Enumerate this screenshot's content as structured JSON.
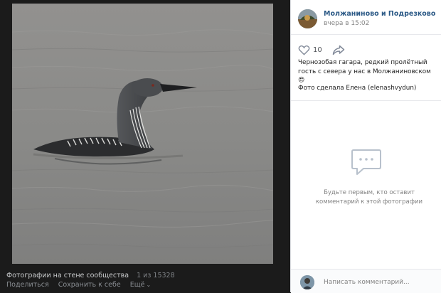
{
  "viewer": {
    "album_title": "Фотографии на стене сообщества",
    "counter": "1 из 15328",
    "actions": {
      "share": "Поделиться",
      "save": "Сохранить к себе",
      "more": "Ещё"
    }
  },
  "post": {
    "group_name": "Молжаниново и Подрезково",
    "time": "вчера в 15:02",
    "likes": "10",
    "description": "Чернозобая гагара, редкий пролётный гость с севера у нас в Молжаниновском 😍",
    "credit": "Фото сделала Елена (elenashvydun)"
  },
  "comments": {
    "empty_line1": "Будьте первым, кто оставит",
    "empty_line2": "комментарий к этой фотографии",
    "placeholder": "Написать комментарий..."
  },
  "colors": {
    "link": "#2a5885",
    "viewer_bg": "#1b1b1b",
    "panel_bg": "#ffffff"
  }
}
